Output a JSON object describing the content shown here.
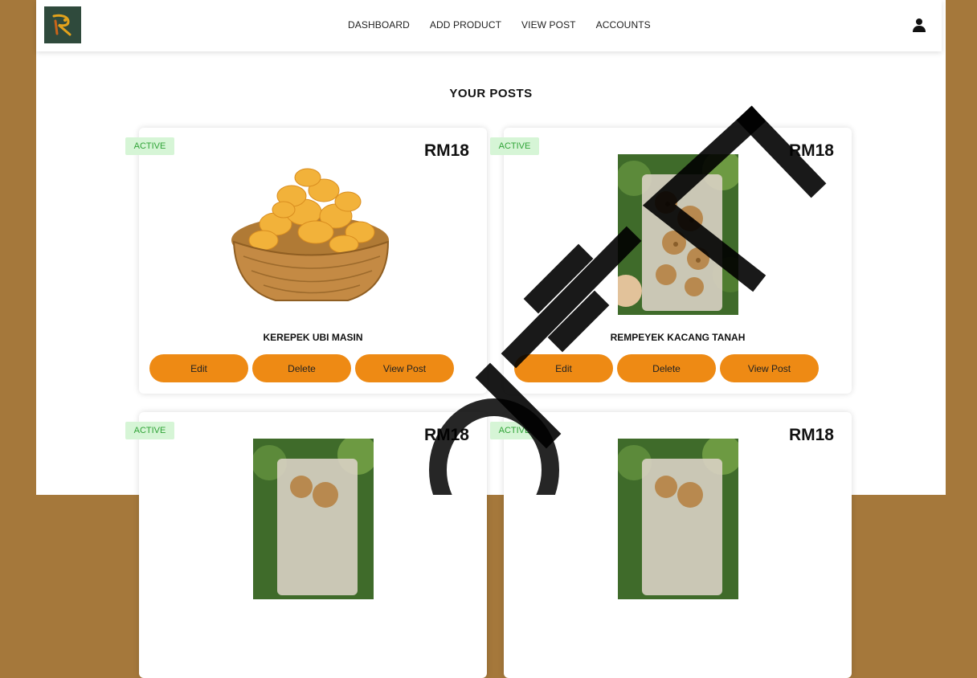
{
  "nav": {
    "links": [
      "DASHBOARD",
      "ADD PRODUCT",
      "VIEW POST",
      "ACCOUNTS"
    ]
  },
  "heading": "YOUR POSTS",
  "posts": [
    {
      "status": "ACTIVE",
      "price": "RM18",
      "name": "KEREPEK UBI MASIN",
      "image": "chips-basket"
    },
    {
      "status": "ACTIVE",
      "price": "RM18",
      "name": "REMPEYEK KACANG TANAH",
      "image": "peanut-cracker-bag"
    },
    {
      "status": "ACTIVE",
      "price": "RM18",
      "name": "",
      "image": "cracker-bag"
    },
    {
      "status": "ACTIVE",
      "price": "RM18",
      "name": "",
      "image": "cracker-bag"
    }
  ],
  "buttons": {
    "edit": "Edit",
    "delete": "Delete",
    "view": "View Post"
  },
  "colors": {
    "accent": "#ee8a14",
    "frame": "#a5783b",
    "badge_bg": "#d6f5d6",
    "badge_text": "#2fa336",
    "logo_bg": "#2f4a3c"
  },
  "icons": {
    "logo": "dragon-logo",
    "user": "user-icon"
  }
}
